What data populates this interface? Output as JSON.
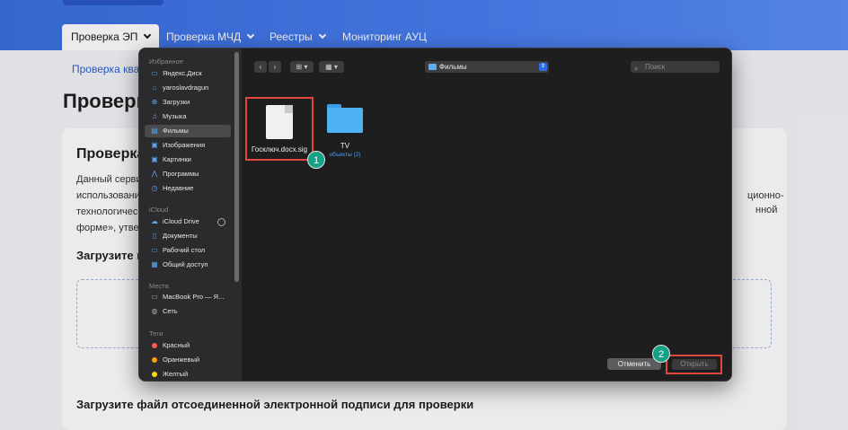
{
  "nav": {
    "tabs": [
      {
        "label": "Проверка ЭП",
        "chevron": true,
        "active": true
      },
      {
        "label": "Проверка МЧД",
        "chevron": true
      },
      {
        "label": "Реестры",
        "chevron": true
      },
      {
        "label": "Мониторинг АУЦ",
        "chevron": false
      }
    ]
  },
  "page": {
    "breadcrumb": "Проверка квал",
    "title": "Проверк",
    "card": {
      "heading": "Проверка",
      "text_lines": [
        "Данный серви",
        "использовани",
        "технологическ",
        "форме», утвер"
      ],
      "text_right": [
        "ционно-",
        "нной"
      ],
      "upload_heading": "Загрузите п",
      "detached_heading": "Загрузите файл отсоединенной электронной подписи для проверки"
    }
  },
  "dialog": {
    "sidebar": {
      "favorites_label": "Избранное",
      "favorites": [
        {
          "label": "Яндекс.Диск",
          "icon": "drive-icon"
        },
        {
          "label": "yaroslavdragun",
          "icon": "home-icon"
        },
        {
          "label": "Загрузки",
          "icon": "downloads-icon"
        },
        {
          "label": "Музыка",
          "icon": "music-icon"
        },
        {
          "label": "Фильмы",
          "icon": "movies-icon",
          "selected": true
        },
        {
          "label": "Изображения",
          "icon": "pictures-icon"
        },
        {
          "label": "Картинки",
          "icon": "images-icon"
        },
        {
          "label": "Программы",
          "icon": "applications-icon"
        },
        {
          "label": "Недавние",
          "icon": "recent-icon"
        }
      ],
      "icloud_label": "iCloud",
      "icloud": [
        {
          "label": "iCloud Drive",
          "icon": "icloud-icon"
        },
        {
          "label": "Документы",
          "icon": "documents-icon"
        },
        {
          "label": "Рабочий стол",
          "icon": "desktop-icon"
        },
        {
          "label": "Общий доступ",
          "icon": "shared-icon"
        }
      ],
      "places_label": "Места",
      "places": [
        {
          "label": "MacBook Pro — Я...",
          "icon": "laptop-icon"
        },
        {
          "label": "Сеть",
          "icon": "network-icon"
        }
      ],
      "tags_label": "Теги",
      "tags": [
        {
          "label": "Красный",
          "color": "#ff5a52"
        },
        {
          "label": "Оранжевый",
          "color": "#ff9f0a"
        },
        {
          "label": "Желтый",
          "color": "#ffd60a"
        }
      ]
    },
    "toolbar": {
      "location": "Фильмы",
      "search_placeholder": "Поиск"
    },
    "items": [
      {
        "name": "Госключ.docx.sig",
        "type": "file"
      },
      {
        "name": "TV",
        "subtitle": "объекты (2)",
        "type": "folder"
      }
    ],
    "badges": {
      "one": "1",
      "two": "2"
    },
    "buttons": {
      "cancel": "Отменить",
      "open": "Открыть"
    },
    "colors": {
      "highlight": "#e0483e",
      "badge": "#16a085",
      "folder": "#4eb2f5"
    }
  }
}
